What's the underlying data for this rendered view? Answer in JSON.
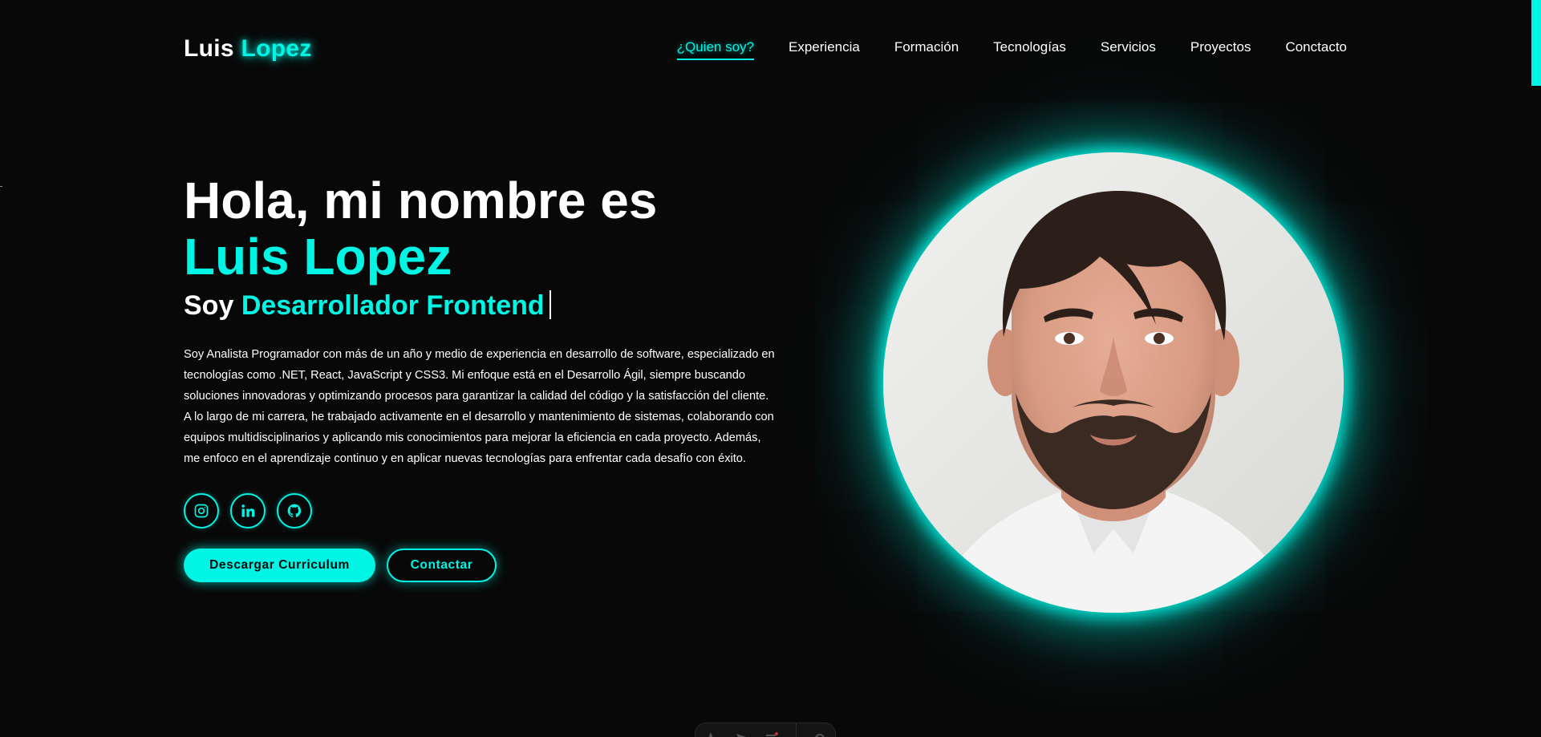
{
  "logo": {
    "first": "Luis",
    "last": "Lopez"
  },
  "nav": {
    "items": [
      "¿Quien soy?",
      "Experiencia",
      "Formación",
      "Tecnologías",
      "Servicios",
      "Proyectos",
      "Conctacto"
    ],
    "active_index": 0
  },
  "hero": {
    "greeting": "Hola, mi nombre es",
    "name": "Luis Lopez",
    "role_prefix": "Soy",
    "role_value": "Desarrollador Frontend",
    "bio": "Soy Analista Programador con más de un año y medio de experiencia en desarrollo de software, especializado en tecnologías como .NET, React, JavaScript y CSS3. Mi enfoque está en el Desarrollo Ágil, siempre buscando soluciones innovadoras y optimizando procesos para garantizar la calidad del código y la satisfacción del cliente. A lo largo de mi carrera, he trabajado activamente en el desarrollo y mantenimiento de sistemas, colaborando con equipos multidisciplinarios y aplicando mis conocimientos para mejorar la eficiencia en cada proyecto. Además, me enfoco en el aprendizaje continuo y en aplicar nuevas tecnologías para enfrentar cada desafío con éxito."
  },
  "socials": [
    {
      "icon": "instagram-icon"
    },
    {
      "icon": "linkedin-icon"
    },
    {
      "icon": "github-icon"
    }
  ],
  "buttons": {
    "download_cv": "Descargar Curriculum",
    "contact": "Contactar"
  },
  "colors": {
    "accent": "#00f5e4",
    "background": "#080808",
    "text": "#ffffff"
  },
  "portrait": {
    "icon": "profile-photo"
  }
}
